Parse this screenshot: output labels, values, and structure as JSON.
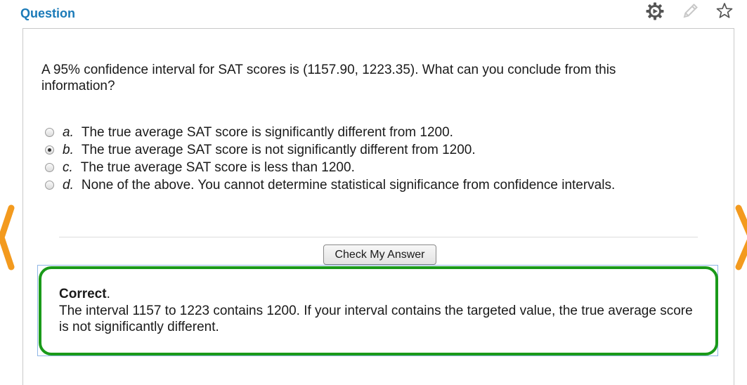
{
  "header": {
    "title": "Question",
    "icons": [
      "settings-gear-icon",
      "pencil-edit-icon",
      "star-favorite-icon"
    ]
  },
  "question": {
    "text": "A 95% confidence interval for SAT scores is (1157.90, 1223.35). What can you conclude from this information?",
    "selected": "b",
    "options": [
      {
        "letter": "a.",
        "text": "The true average SAT score is significantly different from 1200.",
        "checked": false
      },
      {
        "letter": "b.",
        "text": "The true average SAT score is not significantly different from 1200.",
        "checked": true
      },
      {
        "letter": "c.",
        "text": "The true average SAT score is less than 1200.",
        "checked": false
      },
      {
        "letter": "d.",
        "text": "None of the above. You cannot determine statistical significance from confidence intervals.",
        "checked": false
      }
    ]
  },
  "actions": {
    "check_label": "Check My Answer"
  },
  "feedback": {
    "status": "Correct",
    "punct": ".",
    "message": "The interval 1157 to 1223 contains 1200. If your interval contains the targeted value, the true average score is not significantly different."
  },
  "colors": {
    "title": "#1a7ab8",
    "correct_border": "#1a9a1a",
    "nav_arrow": "#f39a1e"
  },
  "navigation": {
    "prev_icon": "chevron-left-icon",
    "next_icon": "chevron-right-icon"
  }
}
